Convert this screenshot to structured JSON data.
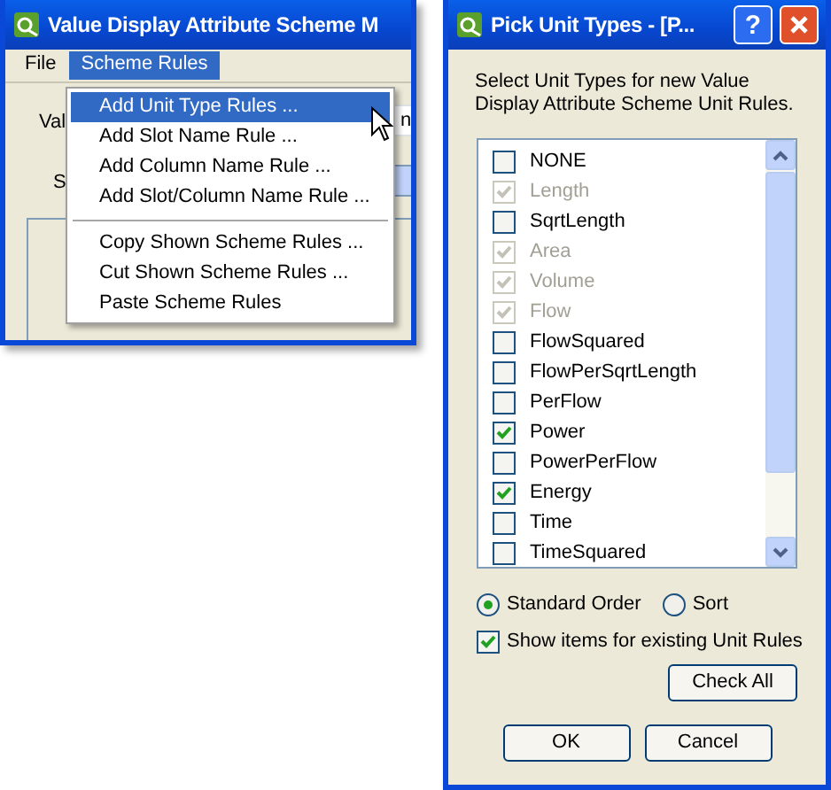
{
  "main_window": {
    "title": "Value Display Attribute Scheme M",
    "menu": [
      {
        "label": "File",
        "selected": false
      },
      {
        "label": "Scheme Rules",
        "selected": true
      }
    ],
    "background_labels": [
      "Val",
      "S"
    ],
    "background_field_text": "n",
    "dropdown": [
      {
        "kind": "item",
        "label": "Add Unit Type Rules ...",
        "selected": true
      },
      {
        "kind": "item",
        "label": "Add Slot Name Rule ...",
        "selected": false
      },
      {
        "kind": "item",
        "label": "Add Column Name Rule ...",
        "selected": false
      },
      {
        "kind": "item",
        "label": "Add Slot/Column Name Rule ...",
        "selected": false
      },
      {
        "kind": "separator"
      },
      {
        "kind": "item",
        "label": "Copy Shown Scheme Rules ...",
        "selected": false
      },
      {
        "kind": "item",
        "label": "Cut Shown Scheme Rules ...",
        "selected": false
      },
      {
        "kind": "item",
        "label": "Paste Scheme Rules",
        "selected": false
      }
    ]
  },
  "dialog": {
    "title": "Pick Unit Types - [P...",
    "help_button": "?",
    "instructions": "Select Unit Types for new Value Display Attribute Scheme Unit Rules.",
    "unit_types": [
      {
        "label": "NONE",
        "checked": false,
        "disabled": false
      },
      {
        "label": "Length",
        "checked": true,
        "disabled": true
      },
      {
        "label": "SqrtLength",
        "checked": false,
        "disabled": false
      },
      {
        "label": "Area",
        "checked": true,
        "disabled": true
      },
      {
        "label": "Volume",
        "checked": true,
        "disabled": true
      },
      {
        "label": "Flow",
        "checked": true,
        "disabled": true
      },
      {
        "label": "FlowSquared",
        "checked": false,
        "disabled": false
      },
      {
        "label": "FlowPerSqrtLength",
        "checked": false,
        "disabled": false
      },
      {
        "label": "PerFlow",
        "checked": false,
        "disabled": false
      },
      {
        "label": "Power",
        "checked": true,
        "disabled": false
      },
      {
        "label": "PowerPerFlow",
        "checked": false,
        "disabled": false
      },
      {
        "label": "Energy",
        "checked": true,
        "disabled": false
      },
      {
        "label": "Time",
        "checked": false,
        "disabled": false
      },
      {
        "label": "TimeSquared",
        "checked": false,
        "disabled": false
      }
    ],
    "order_options": [
      {
        "label": "Standard Order",
        "selected": true
      },
      {
        "label": "Sort",
        "selected": false
      }
    ],
    "show_existing": {
      "label": "Show items for existing Unit Rules",
      "checked": true
    },
    "check_all_button": "Check All",
    "ok_button": "OK",
    "cancel_button": "Cancel"
  }
}
